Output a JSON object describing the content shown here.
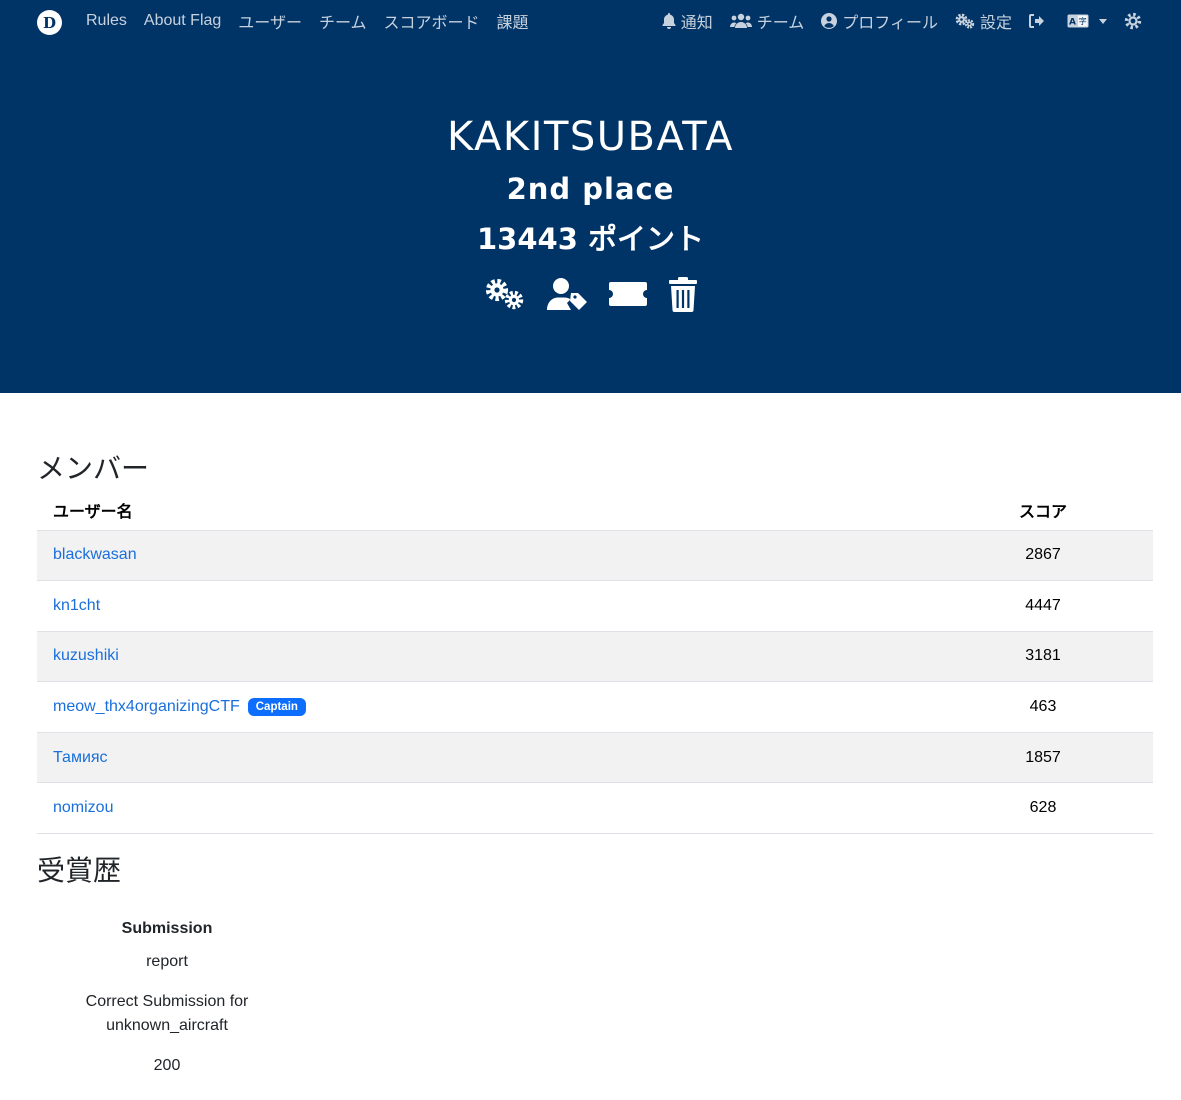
{
  "nav": {
    "brand": "D",
    "left_links": [
      {
        "label": "Rules"
      },
      {
        "label": "About Flag"
      },
      {
        "label": "ユーザー"
      },
      {
        "label": "チーム"
      },
      {
        "label": "スコアボード"
      },
      {
        "label": "課題"
      }
    ],
    "right": {
      "notifications": "通知",
      "team": "チーム",
      "profile": "プロフィール",
      "settings": "設定"
    }
  },
  "team": {
    "name": "KAKITSUBATA",
    "place": "2nd place",
    "points_value": "13443",
    "points_unit": "ポイント"
  },
  "members": {
    "title": "メンバー",
    "columns": {
      "username": "ユーザー名",
      "score": "スコア"
    },
    "rows": [
      {
        "name": "blackwasan",
        "score": "2867",
        "badge": ""
      },
      {
        "name": "kn1cht",
        "score": "4447",
        "badge": ""
      },
      {
        "name": "kuzushiki",
        "score": "3181",
        "badge": ""
      },
      {
        "name": "meow_thx4organizingCTF",
        "score": "463",
        "badge": "Captain"
      },
      {
        "name": "Тамияс",
        "score": "1857",
        "badge": ""
      },
      {
        "name": "nomizou",
        "score": "628",
        "badge": ""
      }
    ]
  },
  "awards": {
    "title": "受賞歴",
    "header": "Submission",
    "name": "report",
    "description": "Correct Submission for unknown_aircraft",
    "value": "200"
  },
  "colors": {
    "header_bg": "#003366",
    "link": "#1a6fdb",
    "badge": "#0d6efd",
    "stripe": "#f2f2f2"
  }
}
